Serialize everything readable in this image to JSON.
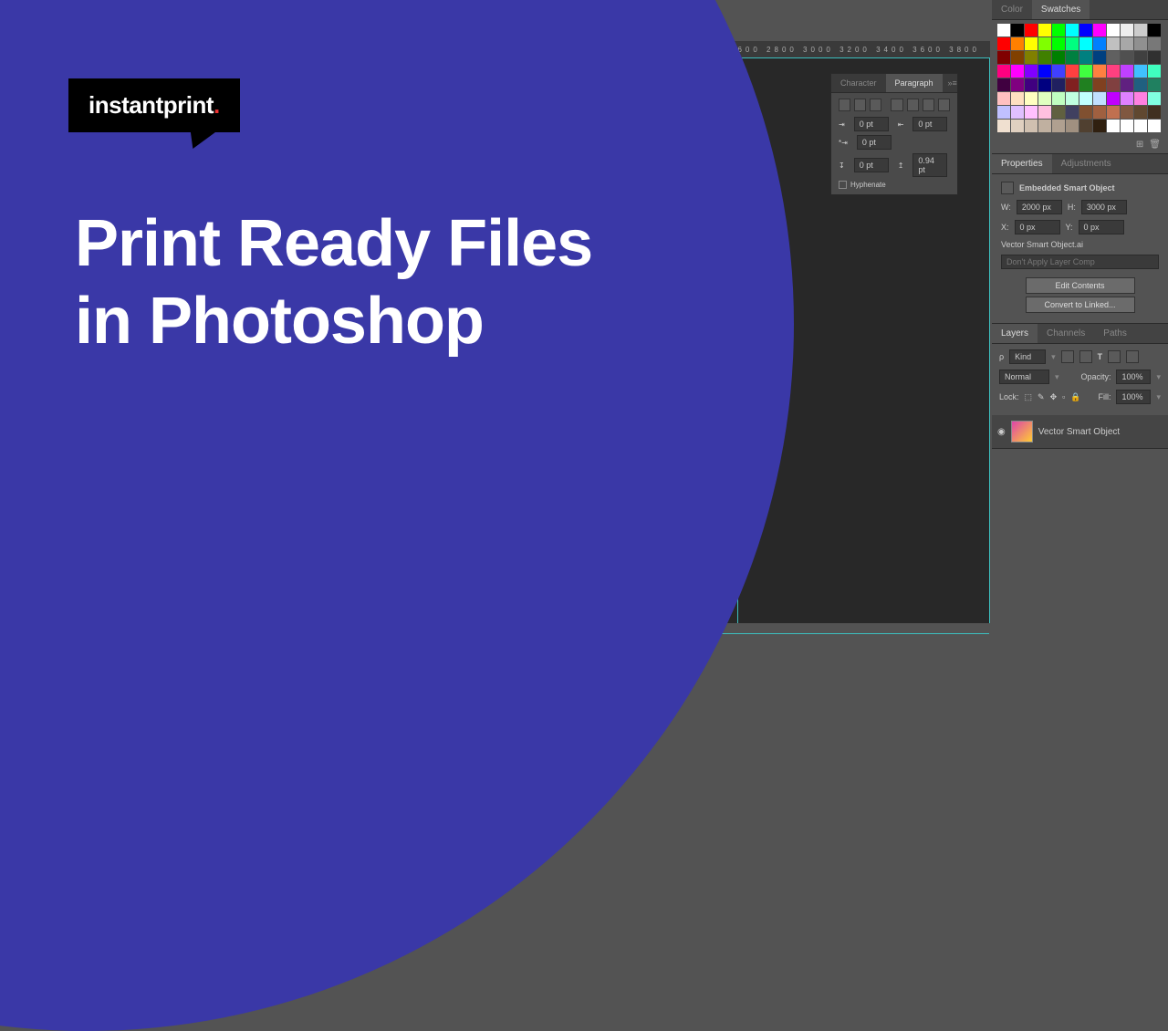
{
  "brand": {
    "name": "instantprint",
    "stop": "."
  },
  "headline": "Print Ready Files\nin Photoshop",
  "ruler": {
    "ticks": "2400   2600   2800   3000   3200   3400   3600   3800"
  },
  "paragraphPanel": {
    "tabs": {
      "character": "Character",
      "paragraph": "Paragraph"
    },
    "indentLeft": "0 pt",
    "indentRight": "0 pt",
    "firstLine": "0 pt",
    "spaceBefore": "0 pt",
    "spaceAfter": "0.94 pt",
    "hyphenate": "Hyphenate"
  },
  "colorPanel": {
    "colorTab": "Color",
    "swatchesTab": "Swatches"
  },
  "swatchColors": [
    "#ffffff",
    "#000000",
    "#ff0000",
    "#ffff00",
    "#00ff00",
    "#00ffff",
    "#0000ff",
    "#ff00ff",
    "#ffffff",
    "#eeeeee",
    "#cccccc",
    "#000000",
    "#ff0000",
    "#ff8000",
    "#ffff00",
    "#80ff00",
    "#00ff00",
    "#00ff80",
    "#00ffff",
    "#0080ff",
    "#c0c0c0",
    "#a8a8a8",
    "#909090",
    "#787878",
    "#800000",
    "#804000",
    "#808000",
    "#408000",
    "#008000",
    "#008040",
    "#008080",
    "#004080",
    "#606060",
    "#505050",
    "#404040",
    "#303030",
    "#ff0080",
    "#ff00ff",
    "#8000ff",
    "#0000ff",
    "#4040ff",
    "#ff4040",
    "#40ff40",
    "#ff8040",
    "#ff4080",
    "#c040ff",
    "#40c0ff",
    "#40ffc0",
    "#400040",
    "#800080",
    "#400080",
    "#000080",
    "#202060",
    "#802020",
    "#208020",
    "#804020",
    "#804040",
    "#602080",
    "#206080",
    "#208060",
    "#ffc0c0",
    "#ffe0c0",
    "#ffffc0",
    "#e0ffc0",
    "#c0ffc0",
    "#c0ffe0",
    "#c0ffff",
    "#c0e0ff",
    "#c000ff",
    "#e080ff",
    "#ff80e0",
    "#80ffe0",
    "#c0c0ff",
    "#e0c0ff",
    "#ffc0ff",
    "#ffc0e0",
    "#606040",
    "#404060",
    "#805030",
    "#a06040",
    "#c07050",
    "#805840",
    "#604830",
    "#403020",
    "#f0e0d0",
    "#e0d0c0",
    "#d0c0b0",
    "#c0b0a0",
    "#b0a090",
    "#a09080",
    "#504030",
    "#302010",
    "#ffffff",
    "#ffffff",
    "#ffffff",
    "#ffffff"
  ],
  "properties": {
    "tabProperties": "Properties",
    "tabAdjustments": "Adjustments",
    "title": "Embedded Smart Object",
    "wLabel": "W:",
    "w": "2000 px",
    "hLabel": "H:",
    "h": "3000 px",
    "xLabel": "X:",
    "x": "0 px",
    "yLabel": "Y:",
    "y": "0 px",
    "filename": "Vector Smart Object.ai",
    "layerComp": "Don't Apply Layer Comp",
    "editBtn": "Edit Contents",
    "convertBtn": "Convert to Linked..."
  },
  "layers": {
    "tabLayers": "Layers",
    "tabChannels": "Channels",
    "tabPaths": "Paths",
    "kind": "Kind",
    "blend": "Normal",
    "opacityLabel": "Opacity:",
    "opacity": "100%",
    "lockLabel": "Lock:",
    "fillLabel": "Fill:",
    "fill": "100%",
    "layerName": "Vector Smart Object"
  }
}
